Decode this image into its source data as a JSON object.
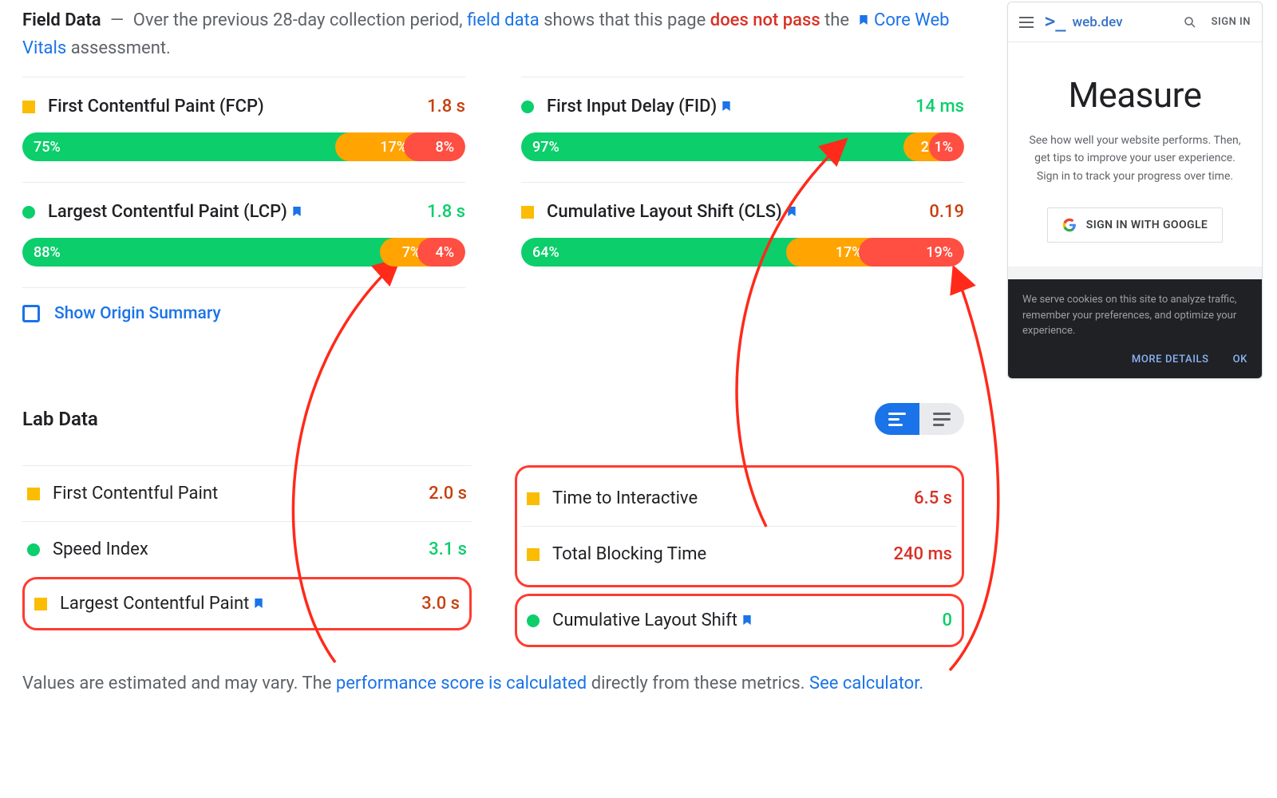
{
  "colors": {
    "good": "#0cce6b",
    "avg": "#fbbc04",
    "poor": "#ff4e42",
    "link": "#1a73e8",
    "fail": "#d93025"
  },
  "fieldData": {
    "titleStrong": "Field Data",
    "dash": "—",
    "prefix": "Over the previous 28-day collection period,",
    "fieldLink": "field data",
    "mid": "shows that this page",
    "fail": "does not pass",
    "the": "the",
    "cwvLink": "Core Web Vitals",
    "suffix": "assessment.",
    "metrics": [
      {
        "id": "fcp",
        "name": "First Contentful Paint (FCP)",
        "value": "1.8 s",
        "status": "orange",
        "shape": "sq",
        "valClass": "val-orange",
        "hasBookmark": false,
        "dist": {
          "g": 75,
          "o": 17,
          "r": 8
        }
      },
      {
        "id": "lcp",
        "name": "Largest Contentful Paint (LCP)",
        "value": "1.8 s",
        "status": "green",
        "shape": "ci",
        "valClass": "val-green",
        "hasBookmark": true,
        "dist": {
          "g": 88,
          "o": 7,
          "r": 4
        }
      },
      {
        "id": "fid",
        "name": "First Input Delay (FID)",
        "value": "14 ms",
        "status": "green",
        "shape": "ci",
        "valClass": "val-green",
        "hasBookmark": true,
        "dist": {
          "g": 97,
          "o": 2,
          "r": 1
        }
      },
      {
        "id": "cls",
        "name": "Cumulative Layout Shift (CLS)",
        "value": "0.19",
        "status": "orange",
        "shape": "sq",
        "valClass": "val-orange",
        "hasBookmark": true,
        "dist": {
          "g": 64,
          "o": 17,
          "r": 19
        }
      }
    ],
    "originToggle": "Show Origin Summary"
  },
  "labData": {
    "title": "Lab Data",
    "rows": [
      {
        "id": "fcp",
        "name": "First Contentful Paint",
        "value": "2.0 s",
        "status": "orange",
        "shape": "sq",
        "valClass": "val-orange",
        "bookmark": false
      },
      {
        "id": "si",
        "name": "Speed Index",
        "value": "3.1 s",
        "status": "green",
        "shape": "ci",
        "valClass": "val-green",
        "bookmark": false
      },
      {
        "id": "lcp",
        "name": "Largest Contentful Paint",
        "value": "3.0 s",
        "status": "orange",
        "shape": "sq",
        "valClass": "val-orange",
        "bookmark": true
      },
      {
        "id": "tti",
        "name": "Time to Interactive",
        "value": "6.5 s",
        "status": "orange",
        "shape": "sq",
        "valClass": "val-red",
        "bookmark": false
      },
      {
        "id": "tbt",
        "name": "Total Blocking Time",
        "value": "240 ms",
        "status": "orange",
        "shape": "sq",
        "valClass": "val-red",
        "bookmark": false
      },
      {
        "id": "cls",
        "name": "Cumulative Layout Shift",
        "value": "0",
        "status": "green",
        "shape": "ci",
        "valClass": "val-green",
        "bookmark": true
      }
    ],
    "footnote1": "Values are estimated and may vary. The",
    "footnoteLink": "performance score is calculated",
    "footnote2": "directly from these metrics.",
    "calcLink": "See calculator."
  },
  "device": {
    "brand": "web.dev",
    "signIn": "SIGN IN",
    "heading": "Measure",
    "desc": "See how well your website performs. Then, get tips to improve your user experience. Sign in to track your progress over time.",
    "googleBtn": "SIGN IN WITH GOOGLE",
    "cookieText": "We serve cookies on this site to analyze traffic, remember your preferences, and optimize your experience.",
    "moreDetails": "MORE DETAILS",
    "ok": "OK"
  }
}
